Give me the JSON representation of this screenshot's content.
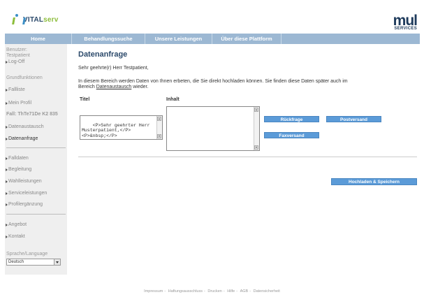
{
  "header": {
    "logo_main": "VITAL",
    "logo_suffix": "serv",
    "brand_word": "mul",
    "brand_sub": "SERVICES"
  },
  "nav": [
    {
      "label": "Home",
      "width": 96
    },
    {
      "label": "Behandlungssuche",
      "width": 105
    },
    {
      "label": "Unsere Leistungen",
      "width": 96
    },
    {
      "label": "Über diese Plattform",
      "width": 99
    }
  ],
  "sidebar": {
    "user_label": "Benutzer:",
    "user_name": "Testpatient",
    "logoff": "Log-Off",
    "basic_functions": "Grundfunktionen",
    "case_list": "Fallliste",
    "my_profile": "Mein Profil",
    "case_id": "Fall: ThTe71De K2 835",
    "data_exchange": "Datenaustausch",
    "data_request": "Datenanfrage",
    "case_data": "Falldaten",
    "support": "Begleitung",
    "optional_services": "Wahlleistungen",
    "service_offers": "Serviceleistungen",
    "profile_supplement": "Profilergänzung",
    "offer": "Angebot",
    "contact": "Kontakt",
    "language_label": "Sprache/Language",
    "language_value": "Deutsch"
  },
  "main": {
    "title": "Datenanfrage",
    "greeting": "Sehr geehrte(r) Herr Testpatient,",
    "info_line1": "In diesem Bereich werden Daten von Ihnen erbeten, die Sie direkt hochladen können. Sie finden diese Daten später auch im",
    "info_prefix": "Bereich ",
    "info_link": "Datenaustausch",
    "info_suffix": " wieder.",
    "col_title": "Titel",
    "col_content": "Inhalt",
    "title_textarea": "<P>Sehr geehrter Herr\nMusterpatient,</P>\n<P>&nbsp;</P>",
    "content_textarea": "",
    "btn_query": "Rückfrage",
    "btn_mail": "Postversand",
    "btn_fax": "Faxversand",
    "btn_upload": "Hochladen & Speichern"
  },
  "footer": [
    "Impressum",
    "Haftungsausschluss",
    "Drucken",
    "Hilfe",
    "AGB",
    "Datensicherheit"
  ],
  "colors": {
    "nav_bg": "#9cb8d3",
    "button_blue": "#5b9bd8",
    "title_blue": "#2c4a6b",
    "sidebar_bg": "#efefef"
  }
}
